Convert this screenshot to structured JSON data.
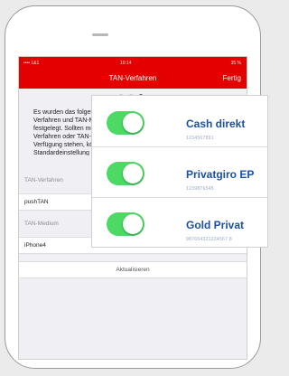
{
  "statusbar": {
    "carrier": "•••• 1&1",
    "time": "10:14",
    "battery": "35 %"
  },
  "navbar": {
    "title": "TAN-Verfahren",
    "done_label": "Fertig"
  },
  "pager": {
    "count": 3,
    "active_index": 2
  },
  "info": {
    "text": "Es wurden das folgende TAN-Verfahren und TAN-Medium festgelegt. Sollten mehrere TAN-Verfahren oder TAN-Medien zur Verfügung stehen, können Sie die Standardeinstellung ändern."
  },
  "sections": {
    "tan_verfahren": {
      "header": "TAN-Verfahren",
      "value": "pushTAN"
    },
    "tan_medium": {
      "header": "TAN-Medium",
      "value": "iPhone4"
    }
  },
  "action": {
    "label": "Aktualisieren"
  },
  "accounts": [
    {
      "name": "Cash direkt",
      "number": "1234567891",
      "enabled": true
    },
    {
      "name": "Privatgiro EP",
      "number": "1239876545",
      "enabled": true
    },
    {
      "name": "Gold Privat",
      "number": "987654321234567 8",
      "enabled": true
    }
  ],
  "colors": {
    "accent_red": "#e50000",
    "toggle_green": "#4cd964",
    "account_blue": "#1a50a8"
  }
}
